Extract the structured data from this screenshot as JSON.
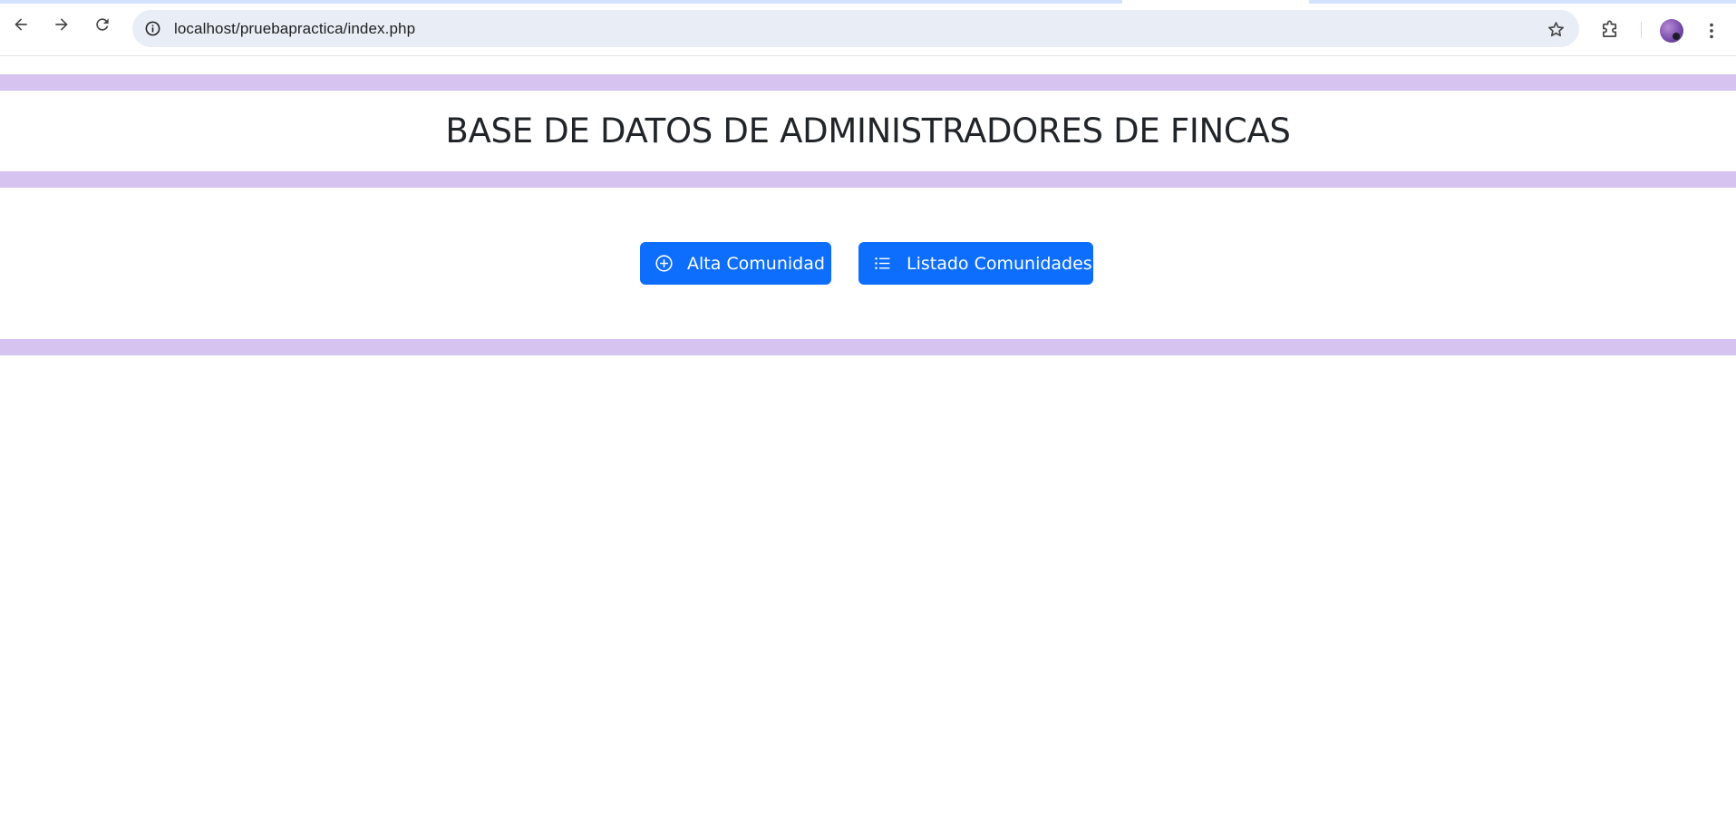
{
  "browser": {
    "url": "localhost/pruebapractica/index.php",
    "icons": {
      "back": "back-arrow-icon",
      "forward": "forward-arrow-icon",
      "reload": "reload-icon",
      "site_info": "site-info-icon",
      "bookmark": "star-icon",
      "extensions": "puzzle-icon",
      "menu": "kebab-menu-icon"
    }
  },
  "page": {
    "title": "BASE DE DATOS DE ADMINISTRADORES DE FINCAS",
    "band_color": "#d6c3ef",
    "buttons": [
      {
        "label": "Alta Comunidad",
        "icon": "plus-circle-icon",
        "color": "#0d6efd"
      },
      {
        "label": "Listado Comunidades",
        "icon": "list-icon",
        "color": "#0d6efd"
      }
    ]
  }
}
